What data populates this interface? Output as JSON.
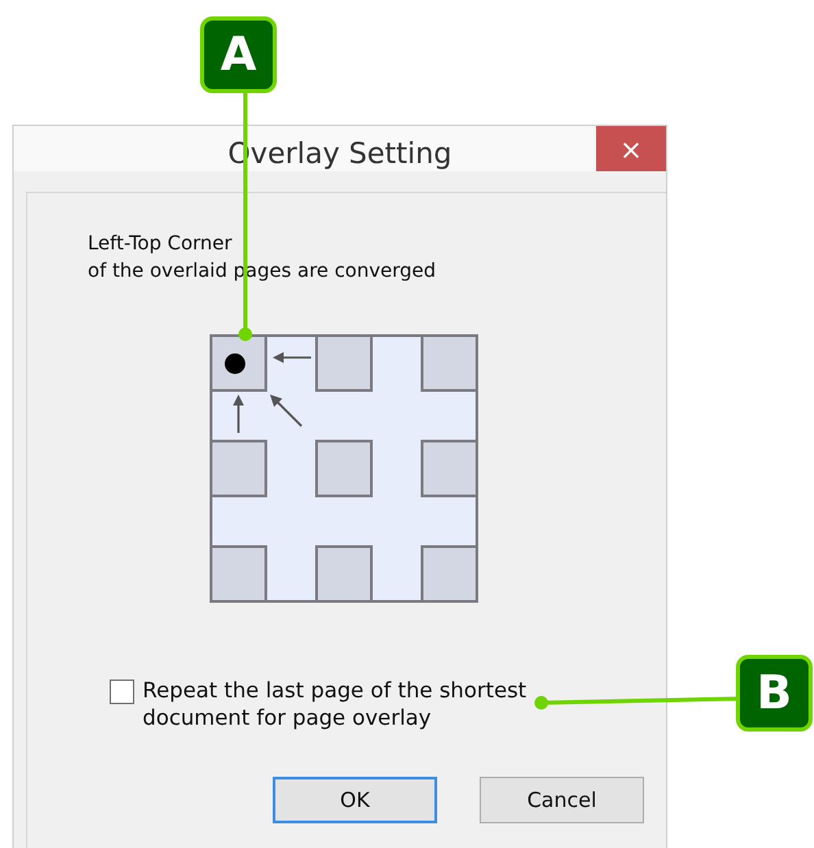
{
  "window": {
    "title": "Overlay Setting",
    "close": "×"
  },
  "description": [
    "Left-Top Corner",
    "of the overlaid pages are converged"
  ],
  "grid": {
    "cells": [
      {
        "selected": true
      },
      {
        "selected": false
      },
      {
        "selected": false
      },
      {
        "selected": false
      },
      {
        "selected": false
      },
      {
        "selected": false
      },
      {
        "selected": false
      },
      {
        "selected": false
      },
      {
        "selected": false
      }
    ]
  },
  "repeat_option": {
    "label": "Repeat the last page of the shortest document for page overlay",
    "checked": false
  },
  "buttons": [
    {
      "label": "OK",
      "default": true
    },
    {
      "label": "Cancel",
      "default": false
    }
  ],
  "callouts": [
    {
      "label": "A"
    },
    {
      "label": "B"
    }
  ]
}
